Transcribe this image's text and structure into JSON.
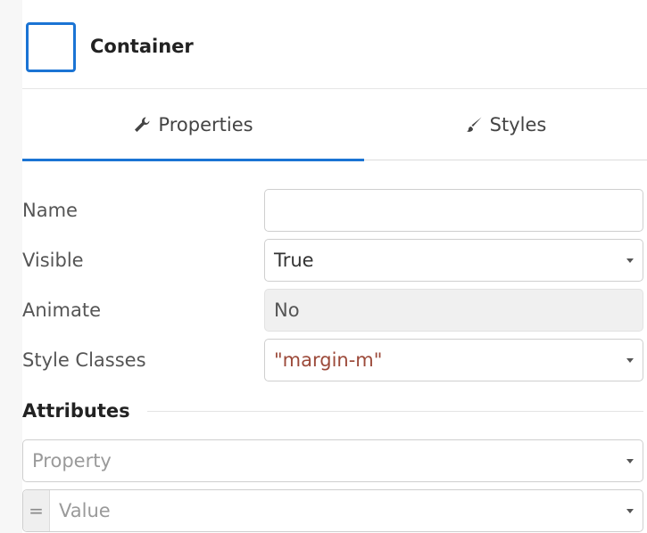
{
  "header": {
    "title": "Container",
    "icon": "container-widget-icon",
    "accent_color": "#1b74d4"
  },
  "tabs": [
    {
      "label": "Properties",
      "icon": "wrench-icon",
      "active": true
    },
    {
      "label": "Styles",
      "icon": "brush-icon",
      "active": false
    }
  ],
  "properties": {
    "name": {
      "label": "Name",
      "value": ""
    },
    "visible": {
      "label": "Visible",
      "value": "True"
    },
    "animate": {
      "label": "Animate",
      "value": "No"
    },
    "style_classes": {
      "label": "Style Classes",
      "value": "\"margin-m\""
    }
  },
  "attributes": {
    "heading": "Attributes",
    "property_placeholder": "Property",
    "value_prefix": "=",
    "value_placeholder": "Value"
  }
}
